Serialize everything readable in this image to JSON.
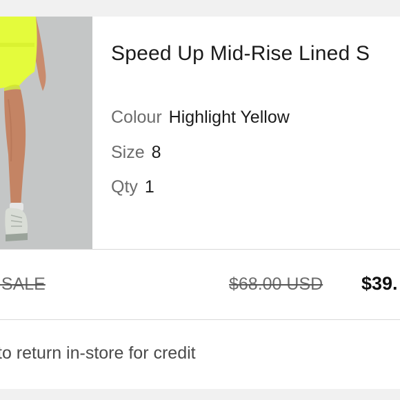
{
  "product": {
    "title": "Speed Up Mid-Rise Lined S",
    "image_icon": "product-photo-shorts",
    "attributes": [
      {
        "label": "Colour",
        "value": "Highlight Yellow"
      },
      {
        "label": "Size",
        "value": "8"
      },
      {
        "label": "Qty",
        "value": "1"
      }
    ]
  },
  "pricing": {
    "sale_tag": "L SALE",
    "original_price": "$68.00 USD",
    "sale_price": "$39."
  },
  "return_note": "to return in-store for credit",
  "colors": {
    "shorts": "#e8ff3a",
    "text_primary": "#1b1b1b",
    "text_secondary": "#6b6b6b",
    "divider": "#d8d8d8"
  }
}
